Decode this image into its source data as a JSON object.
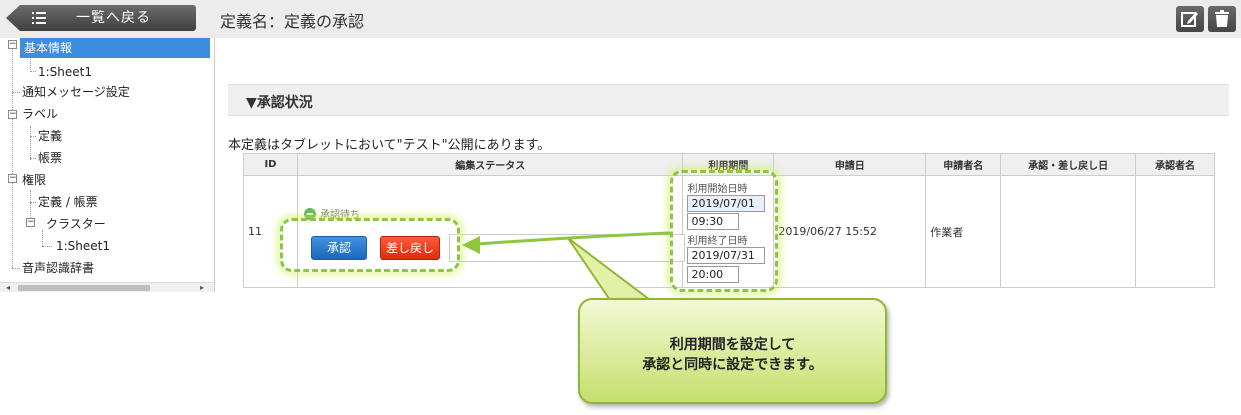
{
  "header": {
    "back_label": "一覧へ戻る",
    "title": "定義名：定義の承認"
  },
  "sidebar": {
    "items": [
      {
        "label": "基本情報"
      },
      {
        "label": "1:Sheet1"
      },
      {
        "label": "通知メッセージ設定"
      },
      {
        "label": "ラベル"
      },
      {
        "label": "定義"
      },
      {
        "label": "帳票"
      },
      {
        "label": "権限"
      },
      {
        "label": "定義 / 帳票"
      },
      {
        "label": "クラスター"
      },
      {
        "label": "1:Sheet1"
      },
      {
        "label": "音声認識辞書"
      }
    ]
  },
  "main": {
    "section_title": "▼承認状況",
    "notice": "本定義はタブレットにおいて\"テスト\"公開にあります。",
    "table": {
      "headers": [
        "ID",
        "編集ステータス",
        "利用期間",
        "申請日",
        "申請者名",
        "承認・差し戻し日",
        "承認者名"
      ],
      "row": {
        "id": "11",
        "status": "承認待ち",
        "approve_label": "承認",
        "reject_label": "差し戻し",
        "start_label": "利用開始日時",
        "start_date": "2019/07/01",
        "start_time": "09:30",
        "end_label": "利用終了日時",
        "end_date": "2019/07/31",
        "end_time": "20:00",
        "applied_date": "2019/06/27 15:52",
        "applicant": "作業者"
      }
    }
  },
  "callout": {
    "line1": "利用期間を設定して",
    "line2": "承認と同時に設定できます。"
  },
  "colors": {
    "highlight": "#8dc63f",
    "approve": "#1c67bb",
    "reject": "#e02a10",
    "selected": "#3d8ee0"
  }
}
